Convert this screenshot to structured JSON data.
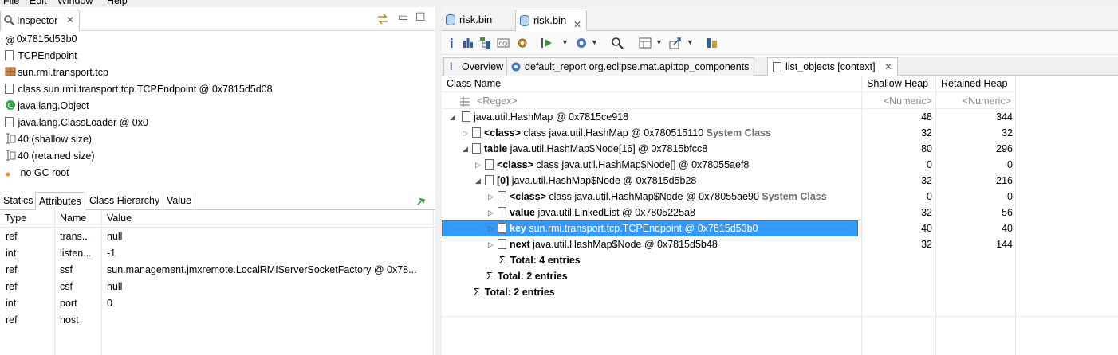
{
  "menu": [
    "File",
    "Edit",
    "Window",
    "Help"
  ],
  "inspector": {
    "tab_label": "Inspector",
    "rows": [
      {
        "icon": "at-icon",
        "text": "0x7815d53b0"
      },
      {
        "icon": "file-icon",
        "text": "TCPEndpoint"
      },
      {
        "icon": "package-icon",
        "text": "sun.rmi.transport.tcp"
      },
      {
        "icon": "class-file-icon",
        "text": "class sun.rmi.transport.tcp.TCPEndpoint @ 0x7815d5d08"
      },
      {
        "icon": "superclass-icon",
        "text": "java.lang.Object"
      },
      {
        "icon": "classloader-icon",
        "text": "java.lang.ClassLoader @ 0x0"
      },
      {
        "icon": "size-icon",
        "text": "40 (shallow size)"
      },
      {
        "icon": "size-icon",
        "text": "40 (retained size)"
      },
      {
        "icon": "gc-root-icon",
        "text": "no GC root"
      }
    ],
    "sub_tabs": [
      "Statics",
      "Attributes",
      "Class Hierarchy",
      "Value"
    ],
    "active_sub_tab": "Attributes",
    "columns": [
      "Type",
      "Name",
      "Value"
    ],
    "attributes": [
      {
        "type": "ref",
        "name": "trans...",
        "value": "null"
      },
      {
        "type": "int",
        "name": "listen...",
        "value": "-1"
      },
      {
        "type": "ref",
        "name": "ssf",
        "value": "sun.management.jmxremote.LocalRMIServerSocketFactory @ 0x78..."
      },
      {
        "type": "ref",
        "name": "csf",
        "value": "null"
      },
      {
        "type": "int",
        "name": "port",
        "value": "0"
      },
      {
        "type": "ref",
        "name": "host",
        "value": ""
      }
    ]
  },
  "editor": {
    "tabs": [
      "risk.bin",
      "risk.bin"
    ],
    "active_tab": 1,
    "query_tabs": [
      "Overview",
      "default_report  org.eclipse.mat.api:top_components",
      "list_objects [context]"
    ],
    "columns": [
      "Class Name",
      "Shallow Heap",
      "Retained Heap"
    ],
    "filter": {
      "name": "<Regex>",
      "shallow": "<Numeric>",
      "retained": "<Numeric>"
    },
    "rows": [
      {
        "indent": 0,
        "twisty": "open",
        "bold": "",
        "text": "java.util.HashMap @ 0x7815ce918",
        "sys": "",
        "shallow": "48",
        "retained": "344"
      },
      {
        "indent": 1,
        "twisty": "closed",
        "bold": "<class>",
        "text": " class java.util.HashMap @ 0x780515110 ",
        "sys": "System Class",
        "shallow": "32",
        "retained": "32"
      },
      {
        "indent": 1,
        "twisty": "open",
        "bold": "table",
        "text": " java.util.HashMap$Node[16] @ 0x7815bfcc8",
        "sys": "",
        "shallow": "80",
        "retained": "296"
      },
      {
        "indent": 2,
        "twisty": "closed",
        "bold": "<class>",
        "text": " class java.util.HashMap$Node[] @ 0x78055aef8",
        "sys": "",
        "shallow": "0",
        "retained": "0"
      },
      {
        "indent": 2,
        "twisty": "open",
        "bold": "[0]",
        "text": " java.util.HashMap$Node @ 0x7815d5b28",
        "sys": "",
        "shallow": "32",
        "retained": "216"
      },
      {
        "indent": 3,
        "twisty": "closed",
        "bold": "<class>",
        "text": " class java.util.HashMap$Node @ 0x78055ae90 ",
        "sys": "System Class",
        "shallow": "0",
        "retained": "0"
      },
      {
        "indent": 3,
        "twisty": "closed",
        "bold": "value",
        "text": " java.util.LinkedList @ 0x7805225a8",
        "sys": "",
        "shallow": "32",
        "retained": "56"
      },
      {
        "indent": 3,
        "twisty": "closed",
        "bold": "key",
        "text": " sun.rmi.transport.tcp.TCPEndpoint @ 0x7815d53b0",
        "sys": "",
        "shallow": "40",
        "retained": "40",
        "selected": true
      },
      {
        "indent": 3,
        "twisty": "closed",
        "bold": "next",
        "text": " java.util.HashMap$Node @ 0x7815d5b48",
        "sys": "",
        "shallow": "32",
        "retained": "144"
      }
    ],
    "totals": [
      {
        "indent": 3,
        "label": "Total: 4 entries"
      },
      {
        "indent": 2,
        "label": "Total: 2 entries"
      },
      {
        "indent": 1,
        "label": "Total: 2 entries"
      }
    ]
  },
  "colors": {
    "selection": "#3399ff",
    "system_class": "#6a6a6a"
  }
}
